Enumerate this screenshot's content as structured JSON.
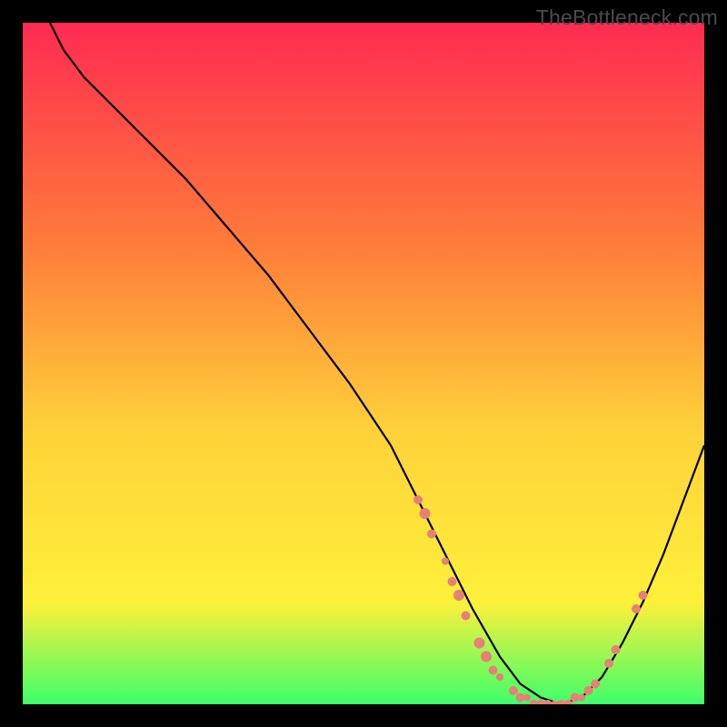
{
  "watermark": "TheBottleneck.com",
  "colors": {
    "gradient_top": "#ff2b52",
    "gradient_mid1": "#ff7a3a",
    "gradient_mid2": "#ffd23a",
    "gradient_mid3": "#fff03a",
    "gradient_bottom": "#3dff6a",
    "curve": "#000000",
    "marker": "#e78076",
    "background": "#000000"
  },
  "chart_data": {
    "type": "line",
    "title": "",
    "xlabel": "",
    "ylabel": "",
    "xlim": [
      0,
      100
    ],
    "ylim": [
      0,
      100
    ],
    "series": [
      {
        "name": "bottleneck-curve",
        "x": [
          4,
          6,
          9,
          13,
          18,
          24,
          30,
          36,
          42,
          48,
          54,
          58,
          62,
          66,
          70,
          73,
          76,
          79,
          82,
          85,
          88,
          91,
          94,
          97,
          100
        ],
        "y": [
          100,
          96,
          92,
          88,
          83,
          77,
          70,
          63,
          55,
          47,
          38,
          30,
          22,
          14,
          7,
          3,
          1,
          0,
          1,
          4,
          9,
          15,
          22,
          30,
          38
        ]
      }
    ],
    "markers": {
      "name": "data-points",
      "points": [
        {
          "x": 58,
          "y": 30,
          "r": 5
        },
        {
          "x": 59,
          "y": 28,
          "r": 6
        },
        {
          "x": 60,
          "y": 25,
          "r": 5
        },
        {
          "x": 62,
          "y": 21,
          "r": 4
        },
        {
          "x": 63,
          "y": 18,
          "r": 5
        },
        {
          "x": 64,
          "y": 16,
          "r": 6
        },
        {
          "x": 65,
          "y": 13,
          "r": 5
        },
        {
          "x": 67,
          "y": 9,
          "r": 6
        },
        {
          "x": 68,
          "y": 7,
          "r": 6
        },
        {
          "x": 69,
          "y": 5,
          "r": 5
        },
        {
          "x": 70,
          "y": 4,
          "r": 4
        },
        {
          "x": 72,
          "y": 2,
          "r": 5
        },
        {
          "x": 73,
          "y": 1,
          "r": 5
        },
        {
          "x": 74,
          "y": 1,
          "r": 4
        },
        {
          "x": 75,
          "y": 0,
          "r": 5
        },
        {
          "x": 76,
          "y": 0,
          "r": 5
        },
        {
          "x": 77,
          "y": 0,
          "r": 5
        },
        {
          "x": 78,
          "y": 0,
          "r": 4
        },
        {
          "x": 79,
          "y": 0,
          "r": 5
        },
        {
          "x": 80,
          "y": 0,
          "r": 5
        },
        {
          "x": 81,
          "y": 1,
          "r": 5
        },
        {
          "x": 82,
          "y": 1,
          "r": 4
        },
        {
          "x": 83,
          "y": 2,
          "r": 5
        },
        {
          "x": 84,
          "y": 3,
          "r": 5
        },
        {
          "x": 86,
          "y": 6,
          "r": 5
        },
        {
          "x": 87,
          "y": 8,
          "r": 5
        },
        {
          "x": 90,
          "y": 14,
          "r": 5
        },
        {
          "x": 91,
          "y": 16,
          "r": 5
        }
      ]
    }
  }
}
